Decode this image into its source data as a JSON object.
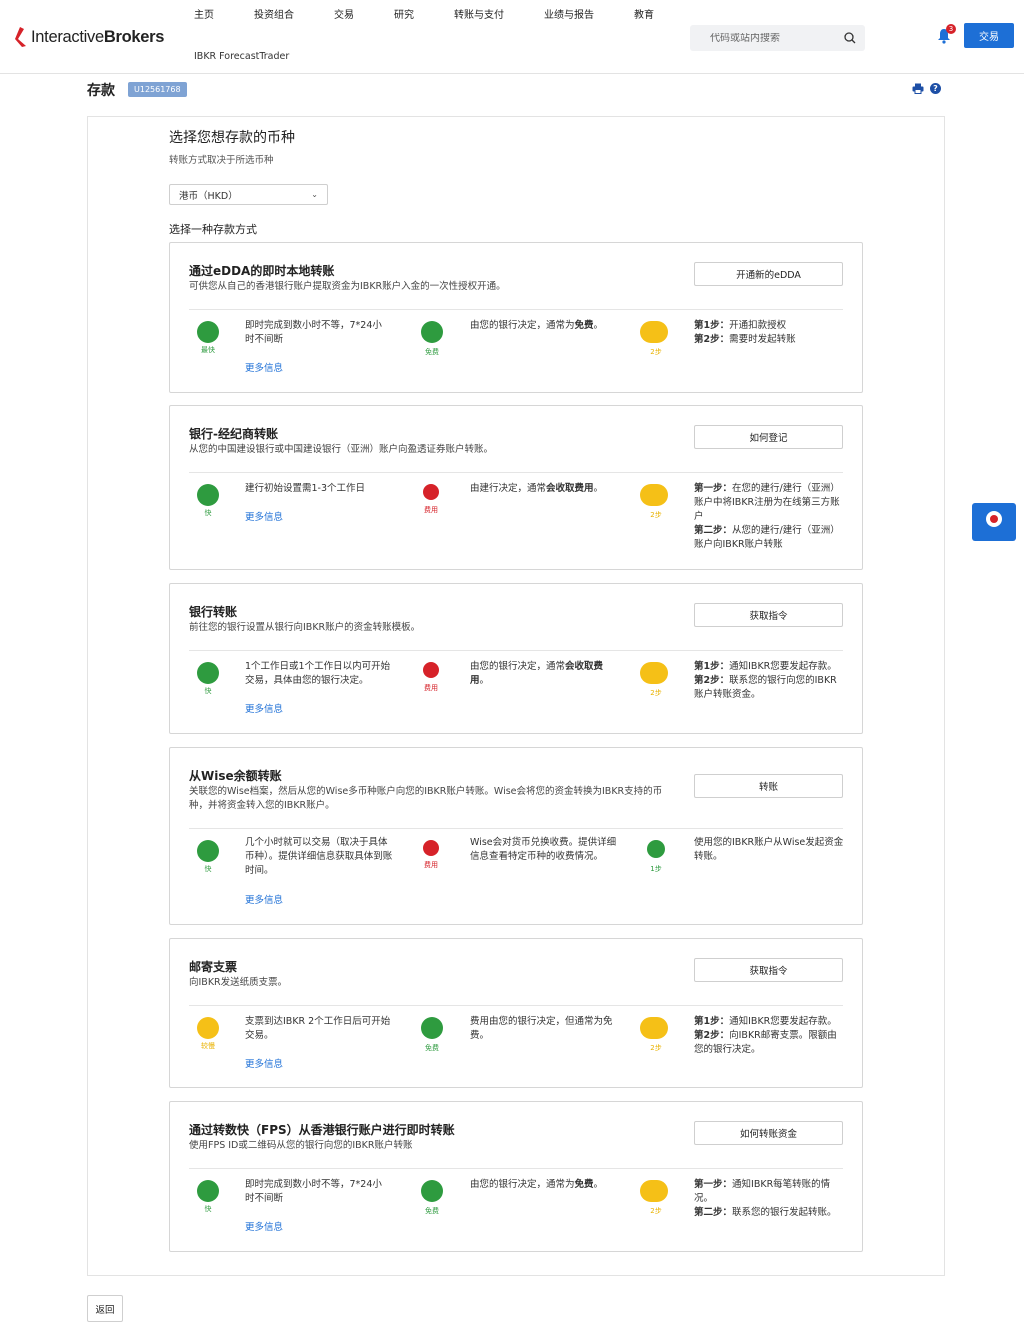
{
  "header": {
    "brand_regular": "Interactive",
    "brand_bold": "Brokers",
    "sub_brand": "IBKR ForecastTrader",
    "nav": [
      "主页",
      "投资组合",
      "交易",
      "研究",
      "转账与支付",
      "业绩与报告",
      "教育"
    ],
    "search_placeholder": "代码或站内搜索",
    "notification_count": "3",
    "trade_label": "交易"
  },
  "page": {
    "title": "存款",
    "account": "U12561768",
    "currency_heading": "选择您想存款的币种",
    "currency_sub": "转账方式取决于所选币种",
    "currency_selected": "港币（HKD）",
    "method_heading": "选择一种存款方式",
    "back_label": "返回"
  },
  "methods": [
    {
      "title": "通过eDDA的即时本地转账",
      "desc": "可供您从自己的香港银行账户提取资金为IBKR账户入金的一次性授权开通。",
      "action": "开通新的eDDA",
      "speed_label": "最快",
      "speed_text": "即时完成到数小时不等，7*24小时不间断",
      "fee_label": "免费",
      "fee_text_pre": "由您的银行决定，通常为",
      "fee_text_bold": "免费",
      "fee_text_post": "。",
      "steps_label": "2步",
      "steps": [
        {
          "k": "第1步：",
          "v": "开通扣款授权"
        },
        {
          "k": "第2步：",
          "v": "需要时发起转账"
        }
      ],
      "more": "更多信息"
    },
    {
      "title": "银行-经纪商转账",
      "desc": "从您的中国建设银行或中国建设银行（亚洲）账户向盈透证券账户转账。",
      "action": "如何登记",
      "speed_label": "快",
      "speed_text": "建行初始设置需1-3个工作日",
      "fee_label": "费用",
      "fee_text_pre": "由建行决定，通常",
      "fee_text_bold": "会收取费用",
      "fee_text_post": "。",
      "steps_label": "2步",
      "steps": [
        {
          "k": "第一步：",
          "v": "在您的建行/建行（亚洲）账户中将IBKR注册为在线第三方账户"
        },
        {
          "k": "第二步：",
          "v": "从您的建行/建行（亚洲）账户向IBKR账户转账"
        }
      ],
      "more": "更多信息"
    },
    {
      "title": "银行转账",
      "desc": "前往您的银行设置从银行向IBKR账户的资金转账模板。",
      "action": "获取指令",
      "speed_label": "快",
      "speed_text": "1个工作日或1个工作日以内可开始交易，具体由您的银行决定。",
      "fee_label": "费用",
      "fee_text_pre": "由您的银行决定，通常",
      "fee_text_bold": "会收取费用",
      "fee_text_post": "。",
      "steps_label": "2步",
      "steps": [
        {
          "k": "第1步：",
          "v": "通知IBKR您要发起存款。"
        },
        {
          "k": "第2步：",
          "v": "联系您的银行向您的IBKR账户转账资金。"
        }
      ],
      "more": "更多信息"
    },
    {
      "title": "从Wise余额转账",
      "desc": "关联您的Wise档案，然后从您的Wise多币种账户向您的IBKR账户转账。Wise会将您的资金转换为IBKR支持的币种，并将资金转入您的IBKR账户。",
      "action": "转账",
      "speed_label": "快",
      "speed_text": "几个小时就可以交易（取决于具体币种）。提供详细信息获取具体到账时间。",
      "fee_label": "费用",
      "fee_text_pre": "Wise会对货币兑换收费。提供详细信息查看特定币种的收费情况。",
      "fee_text_bold": "",
      "fee_text_post": "",
      "steps_label": "1步",
      "steps": [
        {
          "k": "",
          "v": "使用您的IBKR账户从Wise发起资金转账。"
        }
      ],
      "more": "更多信息"
    },
    {
      "title": "邮寄支票",
      "desc": "向IBKR发送纸质支票。",
      "action": "获取指令",
      "speed_label": "较慢",
      "speed_text": "支票到达IBKR 2个工作日后可开始交易。",
      "fee_label": "免费",
      "fee_text_pre": "费用由您的银行决定，但通常为免费。",
      "fee_text_bold": "",
      "fee_text_post": "",
      "steps_label": "2步",
      "steps": [
        {
          "k": "第1步：",
          "v": "通知IBKR您要发起存款。"
        },
        {
          "k": "第2步：",
          "v": "向IBKR邮寄支票。限额由您的银行决定。"
        }
      ],
      "more": "更多信息"
    },
    {
      "title": "通过转数快（FPS）从香港银行账户进行即时转账",
      "desc": "使用FPS ID或二维码从您的银行向您的IBKR账户转账",
      "action": "如何转账资金",
      "speed_label": "快",
      "speed_text": "即时完成到数小时不等，7*24小时不间断",
      "fee_label": "免费",
      "fee_text_pre": "由您的银行决定，通常为",
      "fee_text_bold": "免费",
      "fee_text_post": "。",
      "steps_label": "2步",
      "steps": [
        {
          "k": "第一步：",
          "v": "通知IBKR每笔转账的情况。"
        },
        {
          "k": "第二步：",
          "v": "联系您的银行发起转账。"
        }
      ],
      "more": "更多信息"
    }
  ],
  "colors": {
    "green": "#2e9b3f",
    "red": "#d62229",
    "yellow": "#f5c017",
    "link": "#1d6fd6"
  }
}
